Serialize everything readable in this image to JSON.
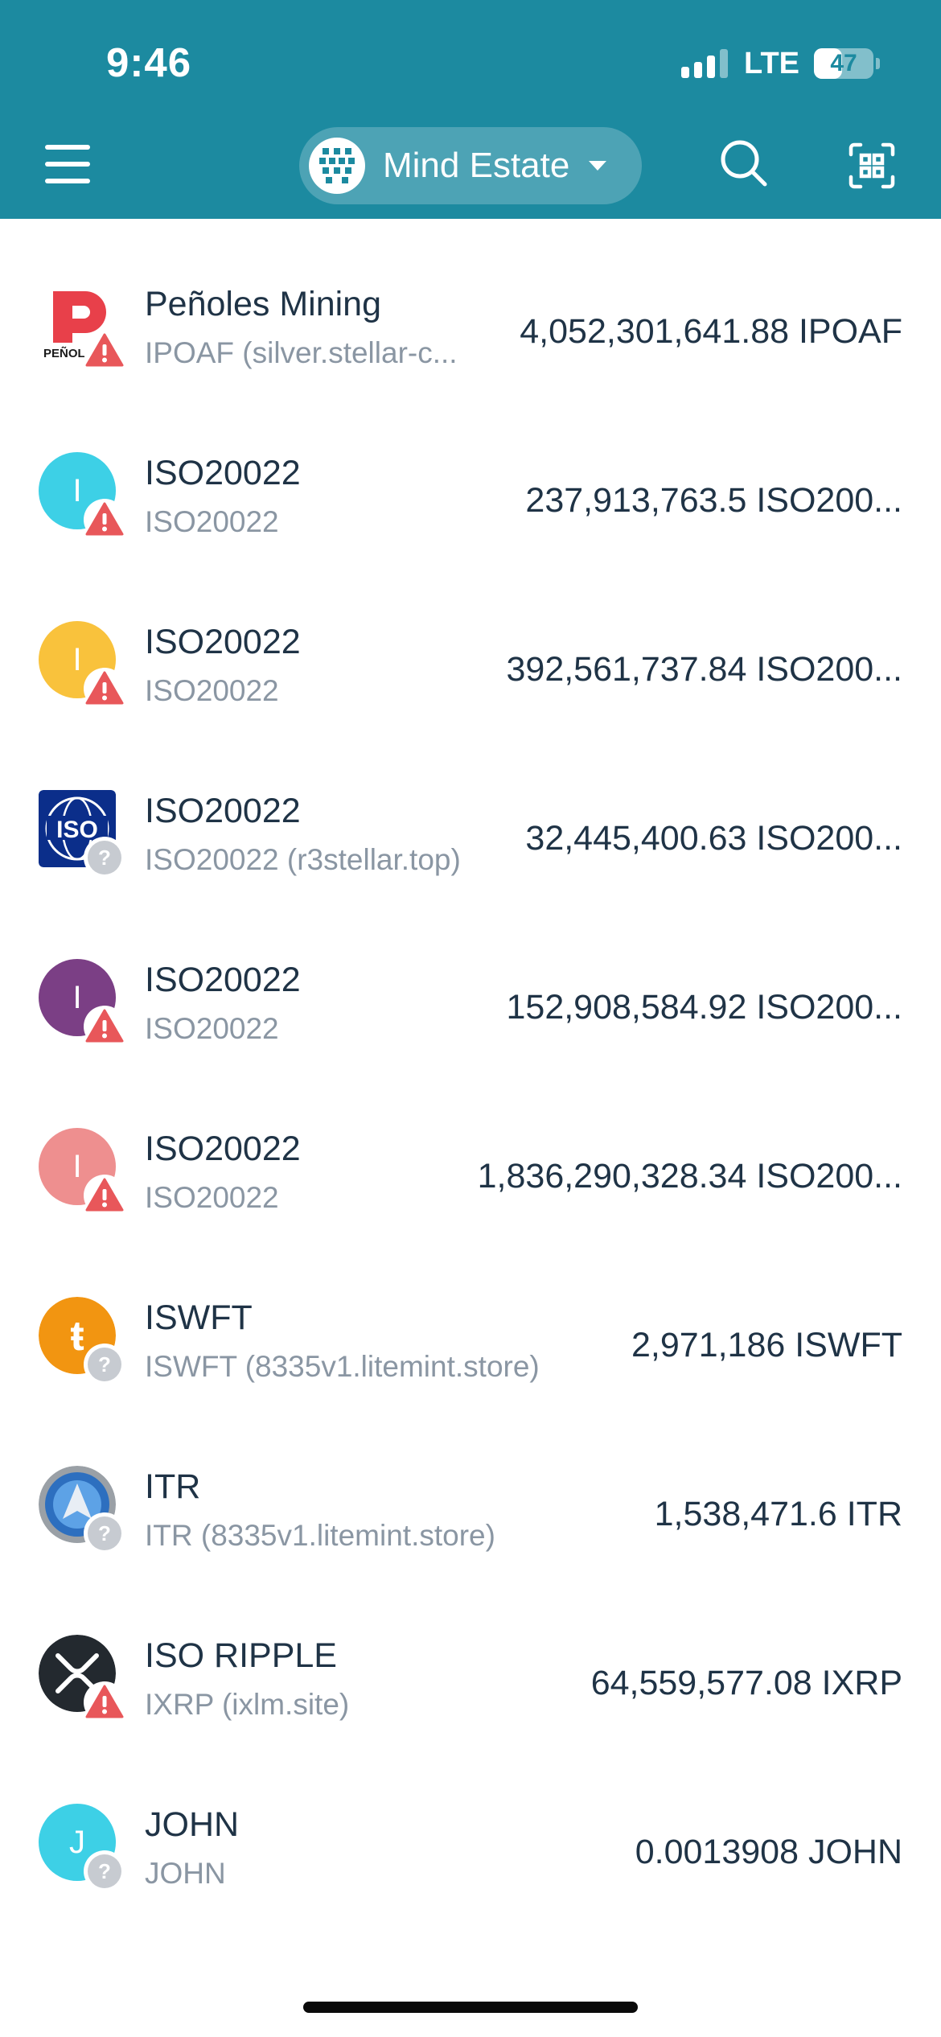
{
  "status_bar": {
    "time": "9:46",
    "network": "LTE",
    "battery_percent": "47",
    "battery_level": 0.47,
    "signal_bars_filled": 3,
    "signal_bars_total": 4
  },
  "header": {
    "account_name": "Mind Estate",
    "menu_icon": "hamburger-menu-icon",
    "search_icon": "search-icon",
    "scan_icon": "qr-scan-icon"
  },
  "colors": {
    "header_bg": "#1c8aa0",
    "warning": "#e8575a",
    "unknown_badge": "#c7cbd1",
    "text": "#1f3346",
    "subtext": "#8a96a3"
  },
  "assets": [
    {
      "name": "Peñoles Mining",
      "subtitle": "IPOAF (silver.stellar-c...",
      "balance": "4,052,301,641.88 IPOAF",
      "icon": "penoles-logo",
      "badge": "warning"
    },
    {
      "name": "ISO20022",
      "subtitle": "ISO20022",
      "balance": "237,913,763.5 ISO200...",
      "icon": "letter-I",
      "icon_color": "#3dd0e6",
      "badge": "warning"
    },
    {
      "name": "ISO20022",
      "subtitle": "ISO20022",
      "balance": "392,561,737.84 ISO200...",
      "icon": "letter-I",
      "icon_color": "#f9c23c",
      "badge": "warning"
    },
    {
      "name": "ISO20022",
      "subtitle": "ISO20022 (r3stellar.top)",
      "balance": "32,445,400.63 ISO200...",
      "icon": "iso-logo",
      "badge": "unknown"
    },
    {
      "name": "ISO20022",
      "subtitle": "ISO20022",
      "balance": "152,908,584.92 ISO200...",
      "icon": "letter-I",
      "icon_color": "#7b3f85",
      "badge": "warning"
    },
    {
      "name": "ISO20022",
      "subtitle": "ISO20022",
      "balance": "1,836,290,328.34 ISO200...",
      "icon": "letter-I",
      "icon_color": "#ee8f8f",
      "badge": "warning"
    },
    {
      "name": "ISWFT",
      "subtitle": "ISWFT (8335v1.litemint.store)",
      "balance": "2,971,186 ISWFT",
      "icon": "iswft-logo",
      "badge": "unknown"
    },
    {
      "name": "ITR",
      "subtitle": "ITR (8335v1.litemint.store)",
      "balance": "1,538,471.6 ITR",
      "icon": "itr-logo",
      "badge": "unknown"
    },
    {
      "name": "ISO RIPPLE",
      "subtitle": "IXRP (ixlm.site)",
      "balance": "64,559,577.08 IXRP",
      "icon": "xrp-logo",
      "badge": "warning"
    },
    {
      "name": "JOHN",
      "subtitle": "JOHN",
      "balance": "0.0013908 JOHN",
      "icon": "letter-J",
      "icon_color": "#3dd0e6",
      "badge": "unknown"
    }
  ]
}
